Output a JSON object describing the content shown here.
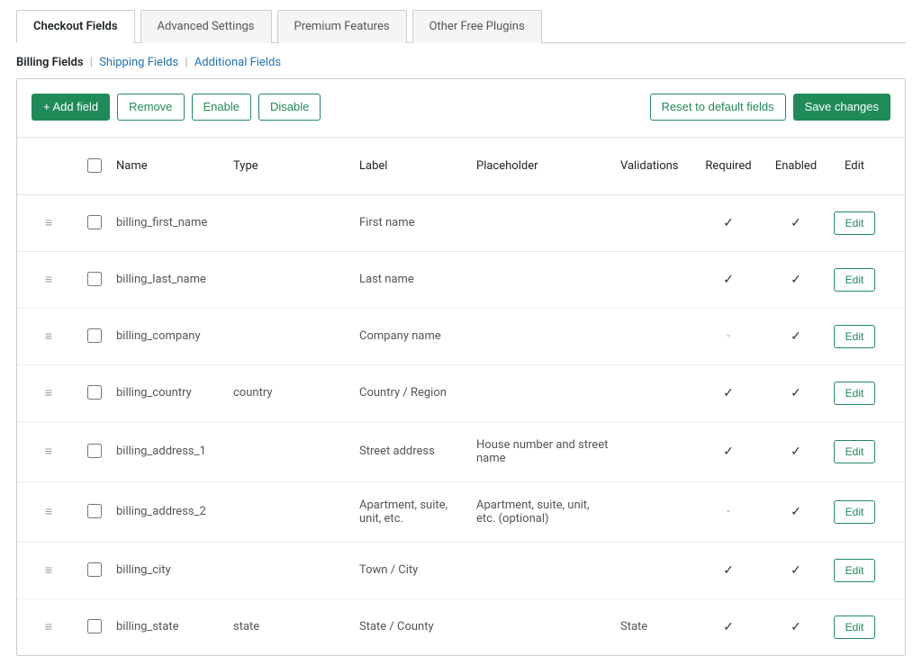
{
  "tabs": {
    "checkout_fields": "Checkout Fields",
    "advanced_settings": "Advanced Settings",
    "premium_features": "Premium Features",
    "other_plugins": "Other Free Plugins"
  },
  "subnav": {
    "billing": "Billing Fields",
    "shipping": "Shipping Fields",
    "additional": "Additional Fields"
  },
  "toolbar": {
    "add_field": "+ Add field",
    "remove": "Remove",
    "enable": "Enable",
    "disable": "Disable",
    "reset": "Reset to default fields",
    "save": "Save changes"
  },
  "headers": {
    "name": "Name",
    "type": "Type",
    "label": "Label",
    "placeholder": "Placeholder",
    "validations": "Validations",
    "required": "Required",
    "enabled": "Enabled",
    "edit": "Edit"
  },
  "edit_label": "Edit",
  "rows": [
    {
      "name": "billing_first_name",
      "type": "",
      "label": "First name",
      "placeholder": "",
      "validations": "",
      "required": true,
      "enabled": true
    },
    {
      "name": "billing_last_name",
      "type": "",
      "label": "Last name",
      "placeholder": "",
      "validations": "",
      "required": true,
      "enabled": true
    },
    {
      "name": "billing_company",
      "type": "",
      "label": "Company name",
      "placeholder": "",
      "validations": "",
      "required": false,
      "enabled": true
    },
    {
      "name": "billing_country",
      "type": "country",
      "label": "Country / Region",
      "placeholder": "",
      "validations": "",
      "required": true,
      "enabled": true
    },
    {
      "name": "billing_address_1",
      "type": "",
      "label": "Street address",
      "placeholder": "House number and street name",
      "validations": "",
      "required": true,
      "enabled": true
    },
    {
      "name": "billing_address_2",
      "type": "",
      "label": "Apartment, suite, unit, etc.",
      "placeholder": "Apartment, suite, unit, etc. (optional)",
      "validations": "",
      "required": false,
      "enabled": true
    },
    {
      "name": "billing_city",
      "type": "",
      "label": "Town / City",
      "placeholder": "",
      "validations": "",
      "required": true,
      "enabled": true
    },
    {
      "name": "billing_state",
      "type": "state",
      "label": "State / County",
      "placeholder": "",
      "validations": "State",
      "required": true,
      "enabled": true
    }
  ]
}
